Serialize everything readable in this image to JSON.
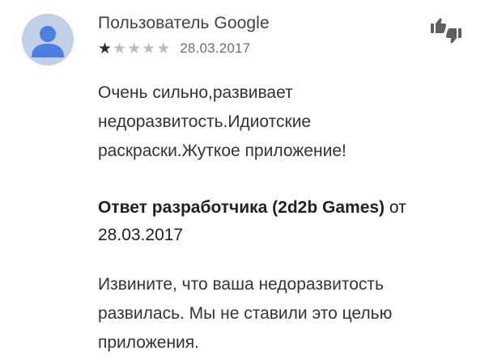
{
  "review": {
    "author": "Пользователь Google",
    "rating": 1,
    "rating_max": 5,
    "date": "28.03.2017",
    "text_lines": [
      "Очень сильно,развивает",
      "недоразвитость.Идиотские",
      "раскраски.Жуткое приложение!"
    ],
    "helpful_icon": "thumb-up-down-icon"
  },
  "developer_reply": {
    "label": "Ответ разработчика (2d2b Games)",
    "from_word": " от",
    "date": "28.03.2017",
    "text_lines": [
      "Извините, что ваша недоразвитость",
      "развилась. Мы не ставили это целью",
      "приложения."
    ]
  },
  "colors": {
    "avatar_bg": "#c3cfe6",
    "avatar_fg": "#4d7fe3",
    "star_on": "#2b2b2b",
    "star_off": "#bdbdbd"
  }
}
